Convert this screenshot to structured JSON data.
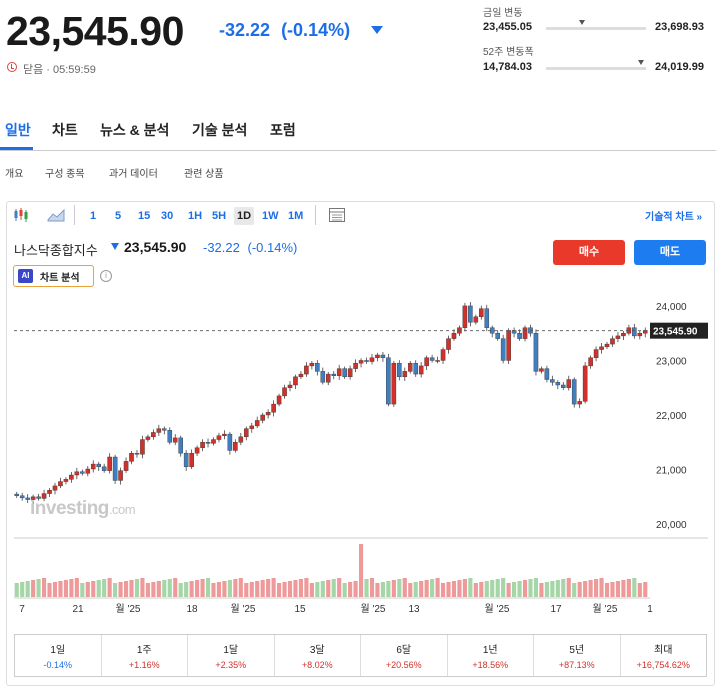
{
  "header": {
    "price": "23,545.90",
    "change": "-32.22",
    "change_pct": "(-0.14%)",
    "status": "닫음 · 05:59:59",
    "day_range_label": "금일 변동",
    "day_low": "23,455.05",
    "day_high": "23,698.93",
    "day_range_position": 0.36,
    "year_range_label": "52주 변동폭",
    "year_low": "14,784.03",
    "year_high": "24,019.99",
    "year_range_position": 0.95
  },
  "main_tabs": [
    "일반",
    "차트",
    "뉴스 & 분석",
    "기술 분석",
    "포럼"
  ],
  "sub_tabs": [
    "개요",
    "구성 종목",
    "과거 데이터",
    "관련 상품"
  ],
  "toolbar": {
    "periods": [
      "1",
      "5",
      "15",
      "30",
      "1H",
      "5H",
      "1D",
      "1W",
      "1M"
    ],
    "active_period": "1D",
    "tech_chart_link": "기술적 차트 »"
  },
  "instrument": {
    "name": "나스닥종합지수",
    "price": "23,545.90",
    "change": "-32.22",
    "change_pct": "(-0.14%)",
    "buy_label": "매수",
    "sell_label": "매도",
    "ai_badge": "AI",
    "ai_label": "차트 분석",
    "info_icon": "i"
  },
  "watermark": {
    "main": "investing",
    "suffix": ".com"
  },
  "colors": {
    "up": "#d0322b",
    "down": "#3f7fc1",
    "accent": "#1d6ee6",
    "buy": "#e8392b",
    "sell": "#1d7df0"
  },
  "chart_data": {
    "type": "candlestick",
    "y_axis": {
      "ticks": [
        "24,000",
        "23,000",
        "22,000",
        "21,000",
        "20,000"
      ],
      "min": 19800,
      "max": 24200
    },
    "x_axis": {
      "ticks": [
        "7",
        "21",
        "월 '25",
        "18",
        "월 '25",
        "15",
        "월 '25",
        "13",
        "월 '25",
        "17",
        "월 '25",
        "1"
      ]
    },
    "last_price_label": "23,545.90",
    "last_price": 23545.9,
    "closes": [
      20520,
      20480,
      20450,
      20500,
      20470,
      20560,
      20620,
      20700,
      20780,
      20820,
      20900,
      20960,
      20930,
      21010,
      21100,
      21050,
      20980,
      21230,
      20800,
      20980,
      21150,
      21300,
      21280,
      21550,
      21600,
      21680,
      21750,
      21720,
      21500,
      21580,
      21300,
      21050,
      21300,
      21400,
      21500,
      21480,
      21550,
      21620,
      21650,
      21350,
      21500,
      21600,
      21750,
      21800,
      21900,
      22000,
      22050,
      22200,
      22350,
      22500,
      22550,
      22700,
      22750,
      22900,
      22950,
      22800,
      22600,
      22750,
      22720,
      22850,
      22700,
      22850,
      22950,
      23000,
      22980,
      23050,
      23100,
      23050,
      22200,
      22950,
      22700,
      22800,
      22950,
      22750,
      22900,
      23050,
      23000,
      23000,
      23200,
      23400,
      23500,
      23600,
      24000,
      23700,
      23800,
      23950,
      23600,
      23500,
      23400,
      23000,
      23550,
      23500,
      23400,
      23600,
      23500,
      22800,
      22850,
      22650,
      22600,
      22550,
      22500,
      22650,
      22200,
      22250,
      22900,
      23050,
      23200,
      23250,
      23300,
      23400,
      23450,
      23500,
      23600,
      23450,
      23500,
      23550
    ],
    "volume_color_flags": "derived from candle direction"
  },
  "performance": [
    {
      "label": "1일",
      "value": "-0.14%",
      "dir": "neg"
    },
    {
      "label": "1주",
      "value": "+1.16%",
      "dir": "pos"
    },
    {
      "label": "1달",
      "value": "+2.35%",
      "dir": "pos"
    },
    {
      "label": "3달",
      "value": "+8.02%",
      "dir": "pos"
    },
    {
      "label": "6달",
      "value": "+20.56%",
      "dir": "pos"
    },
    {
      "label": "1년",
      "value": "+18.56%",
      "dir": "pos"
    },
    {
      "label": "5년",
      "value": "+87.13%",
      "dir": "pos"
    },
    {
      "label": "최대",
      "value": "+16,754.62%",
      "dir": "pos"
    }
  ]
}
